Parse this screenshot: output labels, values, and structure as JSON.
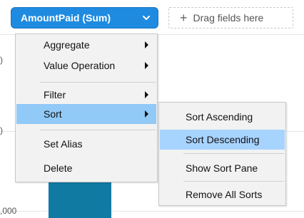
{
  "field_pill": {
    "label": "AmountPaid (Sum)",
    "chevron_icon": "chevron-down-icon"
  },
  "drop_target": {
    "plus_icon": "plus-icon",
    "label": "Drag fields here"
  },
  "axis": {
    "tick_partial_bottom": ",000"
  },
  "context_menu": {
    "items": [
      {
        "label": "Aggregate",
        "has_submenu": true
      },
      {
        "label": "Value Operation",
        "has_submenu": true
      },
      {
        "label": "Filter",
        "has_submenu": true
      },
      {
        "label": "Sort",
        "has_submenu": true,
        "active": true
      },
      {
        "label": "Set Alias",
        "has_submenu": false
      },
      {
        "label": "Delete",
        "has_submenu": false
      }
    ]
  },
  "sort_submenu": {
    "items": [
      {
        "label": "Sort Ascending"
      },
      {
        "label": "Sort Descending",
        "highlighted": true
      },
      {
        "label": "Show Sort Pane"
      },
      {
        "label": "Remove All Sorts"
      }
    ]
  },
  "colors": {
    "pill_blue": "#1f8be0",
    "bar_teal": "#117aa3",
    "menu_highlight": "#a7d3ff",
    "menu_active_parent": "#91c9f7"
  }
}
